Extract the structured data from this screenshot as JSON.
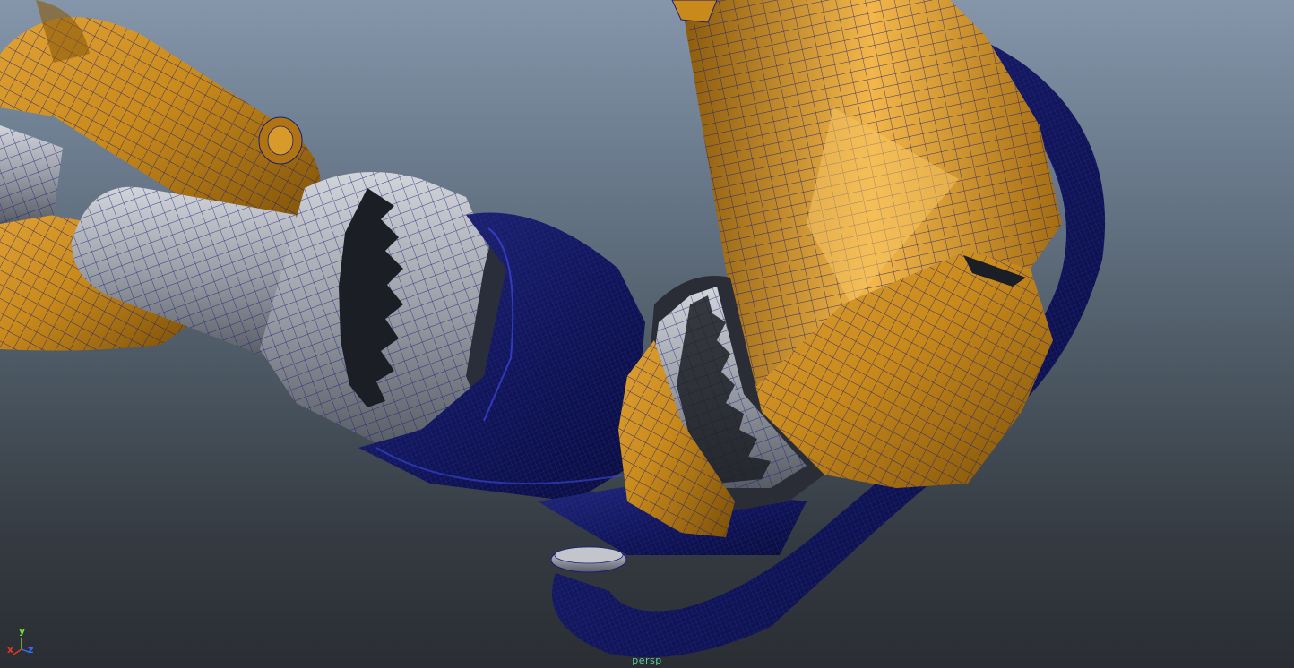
{
  "viewport": {
    "camera_label": "persp",
    "background_gradient": [
      "#8596ab",
      "#4c5863",
      "#2a2e33"
    ],
    "wireframe_color": "#0a0f8c",
    "colors": {
      "gold_shell": "#c98a1c",
      "gold_highlight": "#f2b64a",
      "gold_shadow": "#7a4f08",
      "grey_metal": "#a6aab2",
      "grey_dark": "#4c5058",
      "dark_blue_mesh": "#14195e"
    }
  },
  "axis_gizmo": {
    "y_label": "y",
    "x_label": "x",
    "z_label": "z",
    "y_color": "#7ddc3a",
    "x_color": "#e0392b",
    "z_color": "#3b6bff"
  }
}
